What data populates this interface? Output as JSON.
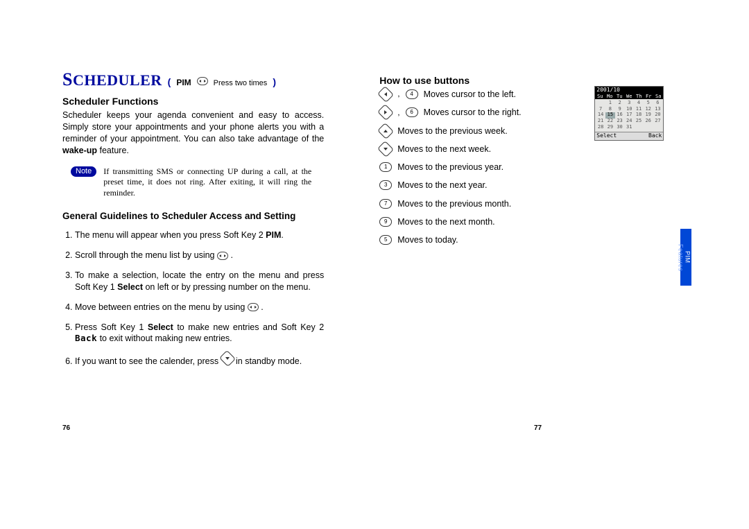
{
  "header": {
    "title": "SCHEDULER",
    "bracket_open": "(",
    "bracket_close": ")",
    "pim_label": "PIM",
    "press_text": "Press two times"
  },
  "left_page": {
    "section1_title": "Scheduler Functions",
    "section1_body": "Scheduler keeps your agenda convenient and easy to access. Simply store your appointments and your phone alerts you with a reminder of your appointment. You can also take advantage of the ",
    "wakeup_bold": "wake-up",
    "section1_tail": " feature.",
    "note_label": "Note",
    "note_text": "If transmitting SMS or connecting UP during a call, at the preset time, it does not ring. After exiting, it will ring the reminder.",
    "section2_title": "General Guidelines to Scheduler Access and Setting",
    "g1_a": "The menu will appear when you press Soft Key 2 ",
    "g1_b": "PIM",
    "g1_c": ".",
    "g2": "Scroll through the menu list by using ",
    "g2_icon_after": " .",
    "g3_a": "To make a selection, locate the entry on the menu and press Soft Key 1 ",
    "g3_b": "Select",
    "g3_c": " on left or by pressing number on the menu.",
    "g4": "Move between entries on the menu by using ",
    "g4_icon_after": " .",
    "g5_a": "Press Soft Key 1 ",
    "g5_b": "Select",
    "g5_c": " to make new entries and Soft Key 2 ",
    "g5_d": "Back",
    "g5_e": " to exit without making new entries.",
    "g6": "If you want to see the calender, press ",
    "g6_tail": " in standby mode."
  },
  "right_page": {
    "title": "How to use buttons",
    "rows": [
      {
        "keys": [
          "left",
          "4"
        ],
        "text": "Moves cursor to the left."
      },
      {
        "keys": [
          "right",
          "6"
        ],
        "text": "Moves cursor to the right."
      },
      {
        "keys": [
          "up"
        ],
        "text": "Moves to the previous week."
      },
      {
        "keys": [
          "down"
        ],
        "text": "Moves to the next week."
      },
      {
        "keys": [
          "1"
        ],
        "text": "Moves to the previous year."
      },
      {
        "keys": [
          "3"
        ],
        "text": "Moves to the next year."
      },
      {
        "keys": [
          "7"
        ],
        "text": "Moves to the previous month."
      },
      {
        "keys": [
          "9"
        ],
        "text": "Moves to the next month."
      },
      {
        "keys": [
          "5"
        ],
        "text": "Moves to today."
      }
    ]
  },
  "calendar": {
    "title": "2001/10",
    "dow": [
      "Su",
      "Mo",
      "Tu",
      "We",
      "Th",
      "Fr",
      "Sa"
    ],
    "cells": [
      "",
      "1",
      "2",
      "3",
      "4",
      "5",
      "6",
      "7",
      "8",
      "9",
      "10",
      "11",
      "12",
      "13",
      "14",
      "15",
      "16",
      "17",
      "18",
      "19",
      "20",
      "21",
      "22",
      "23",
      "24",
      "25",
      "26",
      "27",
      "28",
      "29",
      "30",
      "31",
      "",
      "",
      ""
    ],
    "selected_index": 15,
    "soft_left": "Select",
    "soft_right": "Back"
  },
  "side_tab": {
    "main": "PIM ",
    "sub": "Features"
  },
  "page_numbers": {
    "left": "76",
    "right": "77"
  }
}
